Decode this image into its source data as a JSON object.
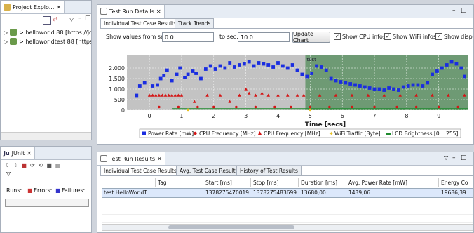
{
  "project_explorer": {
    "title": "Project Explo...",
    "items": [
      {
        "label": "> helloworld 88 [https://jc"
      },
      {
        "label": "> helloworldtest 88 [https:"
      }
    ]
  },
  "junit": {
    "title": "JUnit",
    "runs_label": "Runs:",
    "errors_label": "Errors:",
    "failures_label": "Failures:"
  },
  "test_run_details": {
    "title": "Test Run Details",
    "tabs": [
      {
        "label": "Individual Test Case Results"
      },
      {
        "label": "Track Trends"
      }
    ],
    "show_from_label": "Show values from sec.",
    "from_value": "0.0",
    "to_label": "to sec.",
    "to_value": "10.0",
    "update_button": "Update Chart",
    "checks": [
      {
        "label": "Show CPU infos",
        "checked": true
      },
      {
        "label": "Show WiFi infos",
        "checked": true
      },
      {
        "label": "Show disp",
        "checked": true
      }
    ]
  },
  "chart_data": {
    "type": "scatter",
    "xlabel": "Time [secs]",
    "ylabel": "",
    "xlim": [
      -0.7,
      9.9
    ],
    "ylim": [
      0,
      2600
    ],
    "x_ticks": [
      "0",
      "1",
      "2",
      "3",
      "4",
      "5",
      "6",
      "7",
      "8",
      "9"
    ],
    "y_ticks": [
      "0",
      "500",
      "1.000",
      "1.500",
      "2.000"
    ],
    "region_label": "test",
    "colors": {
      "gray": "#c3c3c3",
      "green": "#6e9a74",
      "blue": "#1a2de0",
      "red": "#d41616",
      "yellow": "#e8c020",
      "lcd": "#1f8a2e"
    },
    "series": [
      {
        "name": "Power Rate [mW]",
        "marker": "square",
        "x": [
          -0.4,
          -0.3,
          -0.15,
          0.1,
          0.25,
          0.35,
          0.45,
          0.55,
          0.7,
          0.85,
          0.95,
          1.1,
          1.2,
          1.35,
          1.45,
          1.6,
          1.75,
          1.9,
          2.05,
          2.2,
          2.35,
          2.5,
          2.65,
          2.8,
          2.95,
          3.1,
          3.25,
          3.4,
          3.55,
          3.7,
          3.85,
          4.0,
          4.15,
          4.3,
          4.45,
          4.6,
          4.75,
          4.9,
          5.05,
          5.2,
          5.35,
          5.5,
          5.65,
          5.8,
          5.95,
          6.1,
          6.25,
          6.4,
          6.55,
          6.7,
          6.85,
          7.0,
          7.15,
          7.3,
          7.45,
          7.6,
          7.75,
          7.9,
          8.05,
          8.2,
          8.35,
          8.5,
          8.65,
          8.8,
          8.95,
          9.1,
          9.25,
          9.4,
          9.55,
          9.7,
          9.8
        ],
        "y": [
          700,
          1150,
          1300,
          1150,
          1200,
          1500,
          1650,
          1900,
          1400,
          1700,
          2000,
          1550,
          1700,
          1850,
          1750,
          1500,
          1950,
          2100,
          1950,
          2100,
          2000,
          2250,
          2050,
          2150,
          2200,
          2300,
          2100,
          2250,
          2200,
          2150,
          2050,
          2250,
          2100,
          2000,
          2150,
          1900,
          1700,
          1600,
          1750,
          2100,
          2050,
          1900,
          1500,
          1400,
          1350,
          1300,
          1250,
          1200,
          1150,
          1100,
          1050,
          1000,
          1000,
          950,
          1050,
          1000,
          950,
          1100,
          1150,
          1200,
          1200,
          1150,
          1300,
          1700,
          1850,
          2000,
          2150,
          2300,
          2200,
          2000,
          1600
        ]
      },
      {
        "name": "CPU Frequency [MHz]",
        "marker": "circle",
        "x": [
          0.3,
          0.9,
          1.5,
          2.0,
          2.7,
          3.3,
          3.9,
          4.4,
          5.0,
          5.6,
          6.3,
          7.0,
          7.7,
          8.3,
          9.0,
          9.6
        ],
        "y": [
          150,
          150,
          150,
          150,
          150,
          150,
          150,
          150,
          150,
          150,
          150,
          150,
          150,
          150,
          150,
          150
        ]
      },
      {
        "name": "CPU Frequency [MHz]",
        "marker": "triangle",
        "x": [
          0.0,
          0.1,
          0.2,
          0.3,
          0.4,
          0.5,
          0.6,
          0.7,
          0.8,
          0.9,
          1.0,
          1.4,
          1.8,
          2.2,
          2.5,
          2.8,
          3.0,
          3.1,
          3.3,
          3.5,
          3.7,
          4.0,
          4.3,
          4.6,
          4.8,
          5.3,
          5.8,
          6.3,
          6.8,
          7.3,
          7.8,
          8.3,
          8.8,
          9.3,
          9.8
        ],
        "y": [
          700,
          700,
          700,
          700,
          700,
          700,
          700,
          700,
          700,
          700,
          700,
          400,
          700,
          700,
          400,
          700,
          1000,
          800,
          700,
          800,
          700,
          700,
          700,
          700,
          700,
          700,
          700,
          700,
          700,
          700,
          700,
          700,
          700,
          700,
          700
        ]
      },
      {
        "name": "WiFi Traffic [Byte]",
        "marker": "star",
        "x": [
          1.2,
          5.0
        ],
        "y": [
          20,
          20
        ]
      },
      {
        "name": "LCD Brightness [0 .. 255]",
        "marker": "square",
        "x": [
          0.7,
          9.9
        ],
        "y": [
          60,
          60
        ]
      }
    ]
  },
  "test_run_results": {
    "title": "Test Run Results",
    "tabs": [
      {
        "label": "Individual Test Case Results"
      },
      {
        "label": "Avg. Test Case Results"
      },
      {
        "label": "History of Test Results"
      }
    ],
    "columns": [
      "Tag",
      "Start [ms]",
      "Stop [ms]",
      "Duration [ms]",
      "Avg. Power Rate [mW]",
      "Energy Co"
    ],
    "rows": [
      {
        "name": "test.HelloWorldT...",
        "tag": "",
        "start": "1378275470019",
        "stop": "1378275483699",
        "duration": "13680,00",
        "power": "1439,06",
        "energy": "19686,39"
      }
    ]
  }
}
